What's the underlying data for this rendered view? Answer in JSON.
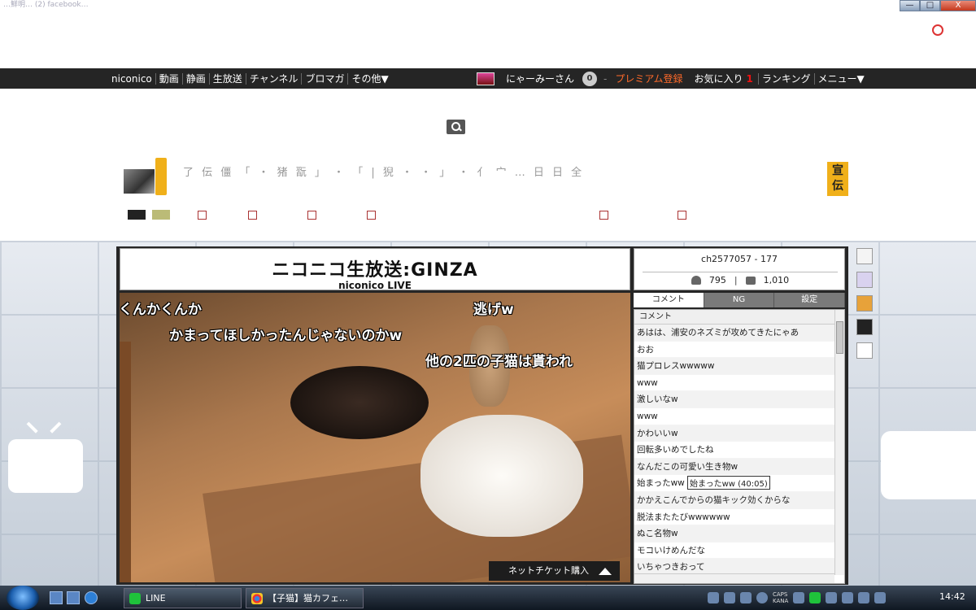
{
  "window": {
    "tab_strip_text": "…鮮明…  (2) facebook…",
    "min": "—",
    "max": "□",
    "close": "X"
  },
  "topbar": {
    "nav_left": [
      "niconico",
      "動画",
      "静画",
      "生放送",
      "チャンネル",
      "ブロマガ",
      "その他▼"
    ],
    "user_name": "にゃーみーさん",
    "points": "0",
    "dash": "-",
    "premium": "プレミアム登録",
    "favorites": "お気に入り",
    "favorites_count": "1",
    "ranking": "ランキング",
    "menu": "メニュー▼"
  },
  "header": {
    "channel_text": "了 伝 僵 「 ・ 猪 翫 」 ・ 「 | 猊 ・ ・ 」 ・ 亻 宀 … 日 日 全",
    "ad_badge": "宣伝"
  },
  "player": {
    "logo_main": "ニコニコ生放送:GINZA",
    "logo_sub": "niconico LIVE",
    "overlay_comments": [
      "くんかくんか",
      "逃げw",
      "かまってほしかったんじゃないのかw",
      "他の2匹の子猫は貰われ"
    ],
    "ticket_button": "ネットチケット購入"
  },
  "side_panel": {
    "channel_id": "ch2577057 - 177",
    "viewers": "795",
    "comments_count": "1,010",
    "tabs": [
      "コメント",
      "NG",
      "設定"
    ],
    "list_header": "コメント",
    "comments": [
      "あはは、浦安のネズミが攻めてきたにゃあ",
      "おお",
      "猫プロレスwwwww",
      "www",
      "激しいなw",
      "www",
      "かわいいw",
      "回転多いめでしたね",
      "なんだこの可愛い生き物w",
      "始まったww",
      "かかえこんでからの猫キック効くからな",
      "脱法またたびwwwwww",
      "ぬこ名物w",
      "モコいけめんだな",
      "いちゃつきおって"
    ],
    "tooltip": "始まったww (40:05)"
  },
  "taskbar": {
    "line_label": "LINE",
    "browser_label": "【子猫】猫カフェ…",
    "caps": "CAPS",
    "kana": "KANA",
    "time": "14:42"
  },
  "colors": {
    "topbar": "#252525",
    "premium": "#ff6a2a",
    "ad": "#f0b01a"
  }
}
